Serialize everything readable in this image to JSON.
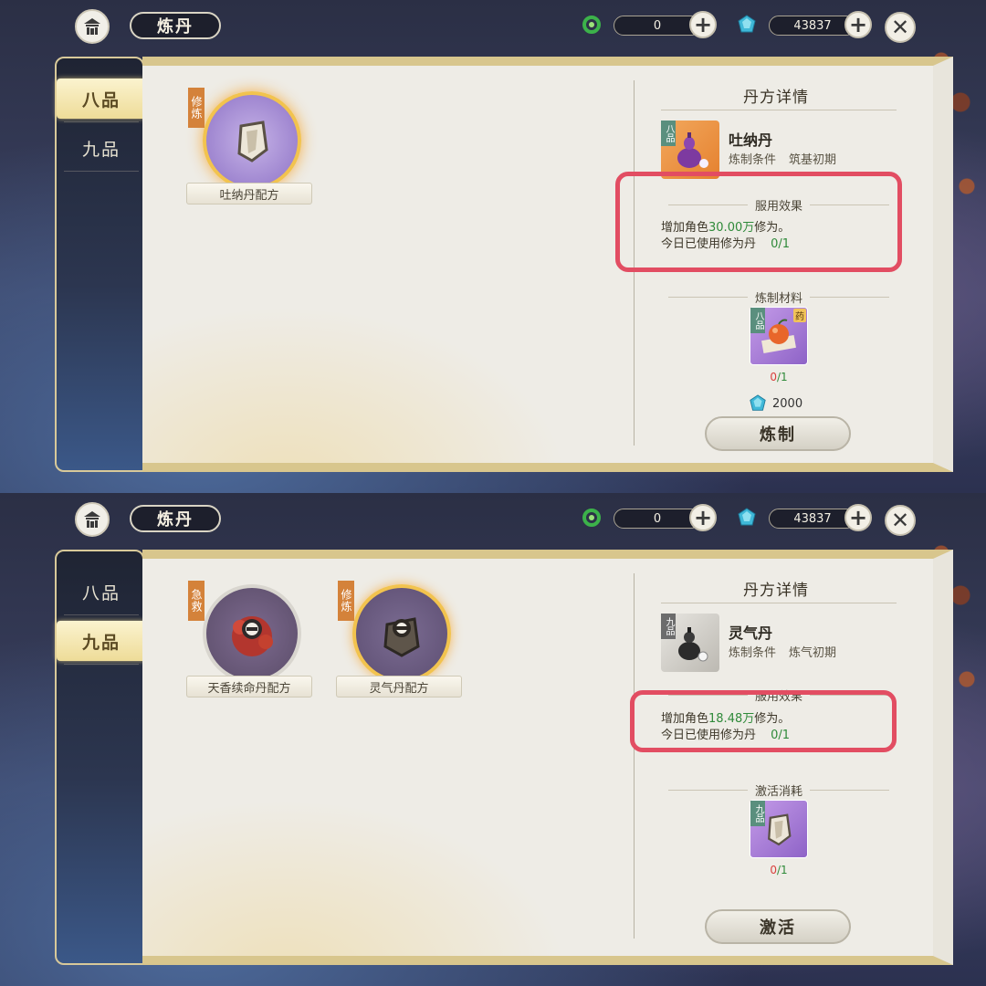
{
  "screens": [
    {
      "header": {
        "title": "炼丹",
        "jade_value": "0",
        "crystal_value": "43837"
      },
      "tabs": [
        {
          "label": "八品",
          "active": true
        },
        {
          "label": "九品",
          "active": false
        }
      ],
      "recipes": [
        {
          "tag": "修炼",
          "label": "吐纳丹配方",
          "icon": "scroll-icon",
          "style": "gold"
        }
      ],
      "detail": {
        "title": "丹方详情",
        "item_name": "吐纳丹",
        "grade_badge": "八品",
        "condition_label": "炼制条件",
        "condition_value": "筑基初期",
        "effect_header": "服用效果",
        "effect_line1_prefix": "增加角色",
        "effect_line1_value": "30.00万",
        "effect_line1_suffix": "修为。",
        "effect_line2_label": "今日已使用修为丹",
        "effect_line2_value": "0/1",
        "material_header": "炼制材料",
        "material_grade_badge": "八品",
        "material_corner_tag": "药",
        "material_count_have": "0",
        "material_count_need": "/1",
        "cost_value": "2000",
        "action_label": "炼制"
      }
    },
    {
      "header": {
        "title": "炼丹",
        "jade_value": "0",
        "crystal_value": "43837"
      },
      "tabs": [
        {
          "label": "八品",
          "active": false
        },
        {
          "label": "九品",
          "active": true
        }
      ],
      "recipes": [
        {
          "tag": "急救",
          "label": "天香续命丹配方",
          "icon": "bundle-icon",
          "style": "grey"
        },
        {
          "tag": "修炼",
          "label": "灵气丹配方",
          "icon": "bundle-icon",
          "style": "gold2"
        }
      ],
      "detail": {
        "title": "丹方详情",
        "item_name": "灵气丹",
        "grade_badge": "九品",
        "condition_label": "炼制条件",
        "condition_value": "炼气初期",
        "effect_header": "服用效果",
        "effect_line1_prefix": "增加角色",
        "effect_line1_value": "18.48万",
        "effect_line1_suffix": "修为。",
        "effect_line2_label": "今日已使用修为丹",
        "effect_line2_value": "0/1",
        "material_header": "激活消耗",
        "material_grade_badge": "九品",
        "material_count_have": "0",
        "material_count_need": "/1",
        "action_label": "激活"
      }
    }
  ],
  "colors": {
    "highlight": "#e24d62",
    "gold": "#f2c34e",
    "green_value": "#2f8a3a",
    "red_value": "#d9403d"
  }
}
